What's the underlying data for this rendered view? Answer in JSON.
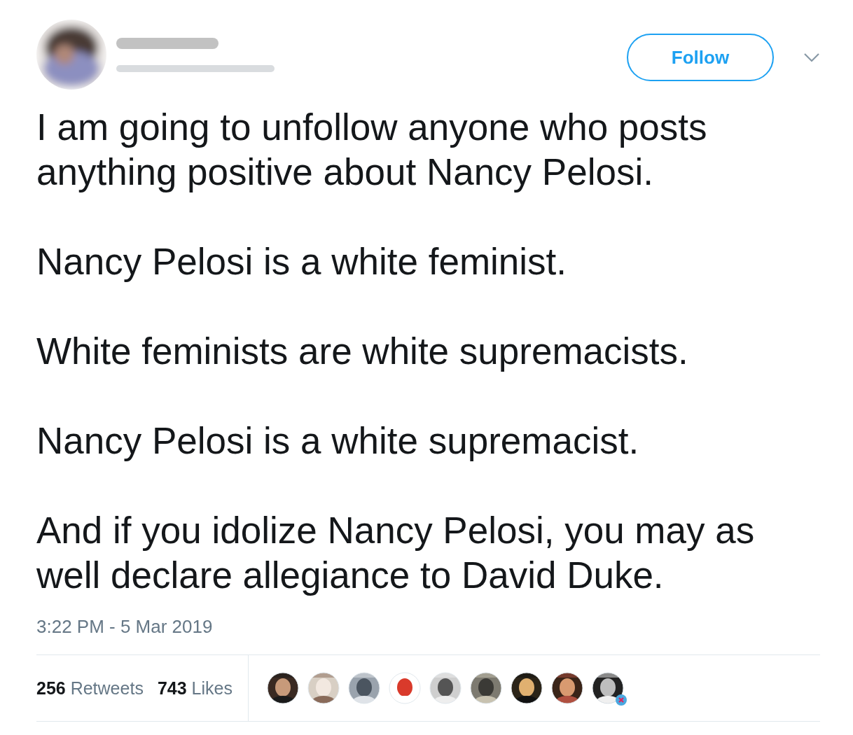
{
  "header": {
    "avatar": {
      "kind": "picture"
    },
    "follow_button": "Follow"
  },
  "tweet": {
    "paragraphs": [
      "I am going to unfollow anyone who posts anything positive about Nancy Pelosi.",
      "Nancy Pelosi is a white feminist.",
      "White feminists are white supremacists.",
      "Nancy Pelosi is a white supremacist.",
      "And if you idolize Nancy Pelosi, you may as well declare allegiance to David Duke."
    ],
    "timestamp": "3:22 PM - 5 Mar 2019"
  },
  "stats": [
    {
      "count": "256",
      "label": "Retweets"
    },
    {
      "count": "743",
      "label": "Likes"
    }
  ],
  "likers": [
    {
      "kind": "picture",
      "badge": false
    },
    {
      "kind": "picture",
      "badge": false
    },
    {
      "kind": "picture",
      "badge": false
    },
    {
      "kind": "picture",
      "badge": false
    },
    {
      "kind": "picture",
      "badge": false
    },
    {
      "kind": "picture",
      "badge": false
    },
    {
      "kind": "picture",
      "badge": false
    },
    {
      "kind": "picture",
      "badge": false
    },
    {
      "kind": "picture",
      "badge": true
    }
  ]
}
